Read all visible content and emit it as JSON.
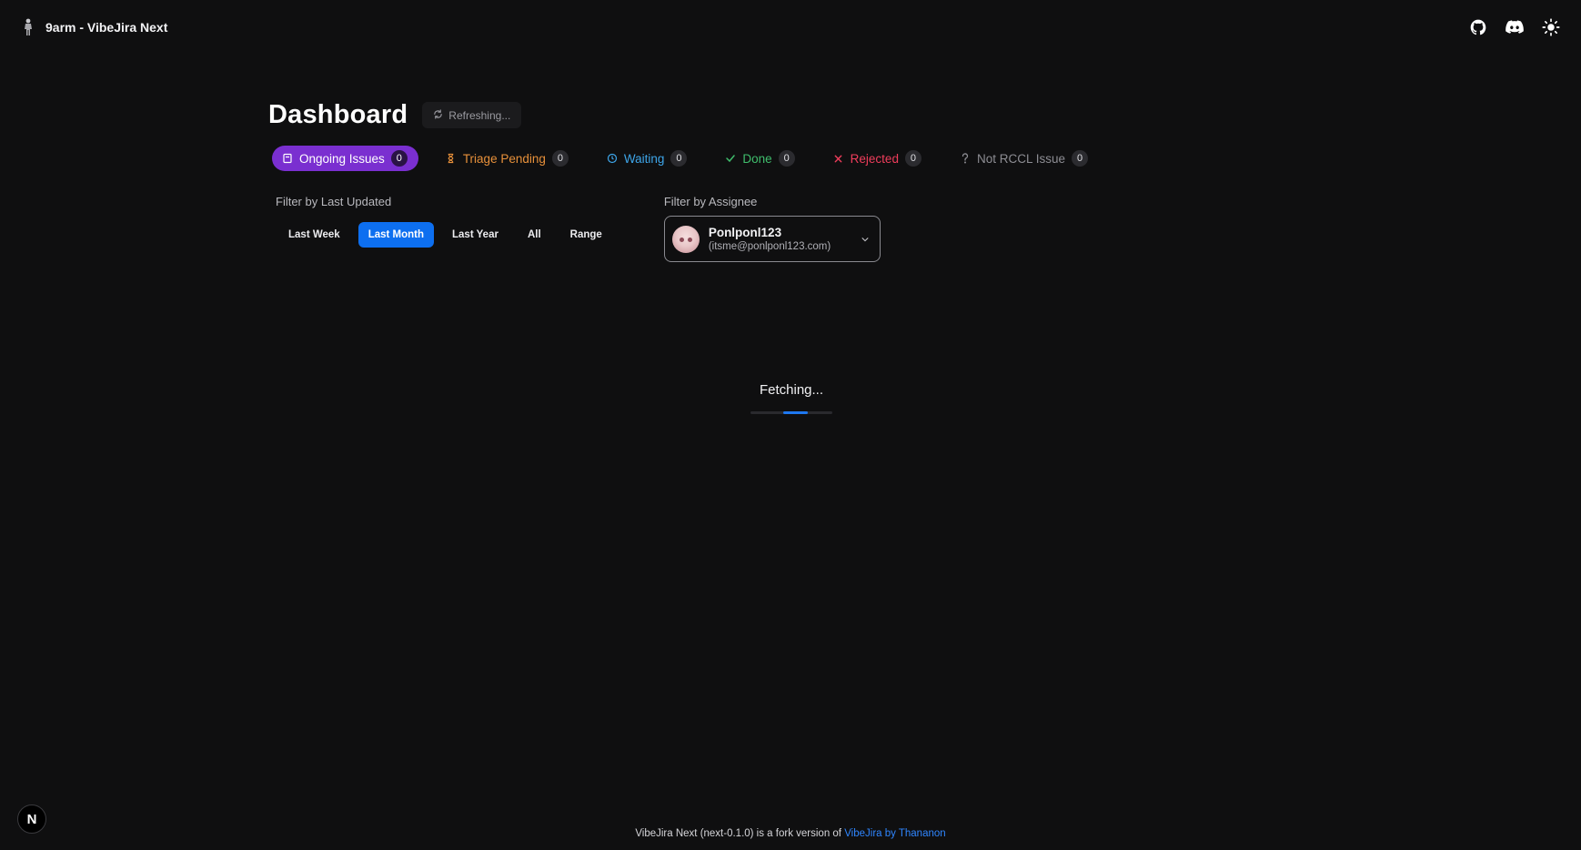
{
  "app": {
    "title": "9arm - VibeJira Next"
  },
  "header_icons": [
    "github-icon",
    "discord-icon",
    "theme-toggle-icon"
  ],
  "dashboard": {
    "title": "Dashboard",
    "refresh_label": "Refreshing..."
  },
  "tabs": [
    {
      "label": "Ongoing Issues",
      "count": "0",
      "color": "#7a2fd0",
      "icon": "ongoing-icon",
      "active": true
    },
    {
      "label": "Triage Pending",
      "count": "0",
      "color": "#e7903a",
      "icon": "hourglass-icon",
      "active": false
    },
    {
      "label": "Waiting",
      "count": "0",
      "color": "#3ea6ea",
      "icon": "clock-icon",
      "active": false
    },
    {
      "label": "Done",
      "count": "0",
      "color": "#3fbd6c",
      "icon": "check-icon",
      "active": false
    },
    {
      "label": "Rejected",
      "count": "0",
      "color": "#ef3d5b",
      "icon": "x-icon",
      "active": false
    },
    {
      "label": "Not RCCL Issue",
      "count": "0",
      "color": "#8d8d93",
      "icon": "question-icon",
      "active": false
    }
  ],
  "filters": {
    "updated_label": "Filter by Last Updated",
    "ranges": [
      {
        "label": "Last Week",
        "active": false
      },
      {
        "label": "Last Month",
        "active": true
      },
      {
        "label": "Last Year",
        "active": false
      },
      {
        "label": "All",
        "active": false
      },
      {
        "label": "Range",
        "active": false
      }
    ],
    "assignee_label": "Filter by Assignee",
    "assignee": {
      "name": "Ponlponl123",
      "email": "(itsme@ponlponl123.com)"
    }
  },
  "loading": {
    "text": "Fetching...",
    "progress": 0.3
  },
  "footer": {
    "text": "VibeJira Next (next-0.1.0) is a fork version of ",
    "link": "VibeJira by Thananon"
  },
  "corner_badge": "N",
  "colors": {
    "background": "#0f0f10",
    "accent_purple": "#7a2fd0",
    "accent_blue": "#0d6ff0",
    "link_blue": "#2f86ff"
  }
}
